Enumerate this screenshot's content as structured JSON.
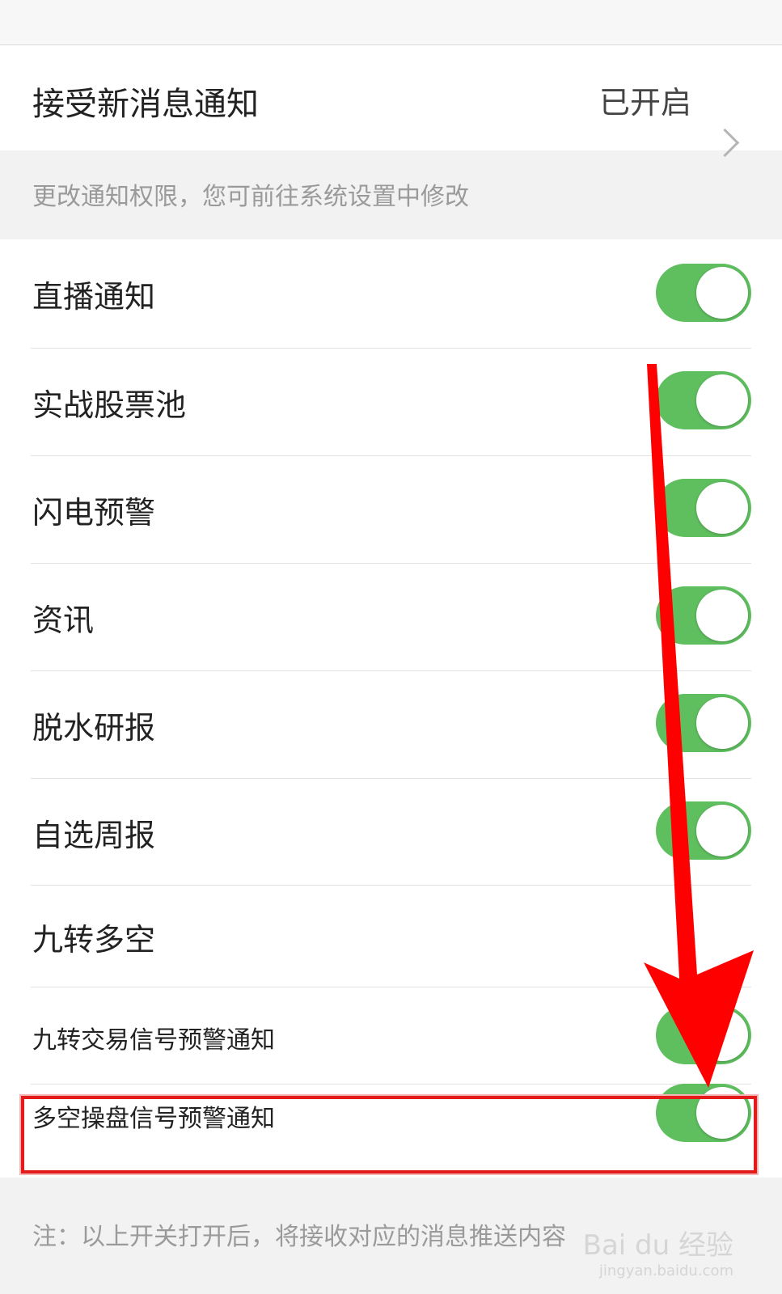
{
  "notification_row": {
    "label": "接受新消息通知",
    "status": "已开启"
  },
  "hint_top": "更改通知权限，您可前往系统设置中修改",
  "items": [
    {
      "label": "直播通知",
      "on": true
    },
    {
      "label": "实战股票池",
      "on": true
    },
    {
      "label": "闪电预警",
      "on": true
    },
    {
      "label": "资讯",
      "on": true
    },
    {
      "label": "脱水研报",
      "on": true
    },
    {
      "label": "自选周报",
      "on": true
    }
  ],
  "section": {
    "label": "九转多空"
  },
  "sub_items": [
    {
      "label": "九转交易信号预警通知",
      "on": true
    },
    {
      "label": "多空操盘信号预警通知",
      "on": true
    }
  ],
  "note": "注：以上开关打开后，将接收对应的消息推送内容",
  "watermark": {
    "brand": "Bai du 经验",
    "url": "jingyan.baidu.com"
  },
  "colors": {
    "toggle_on": "#5fbf5f",
    "highlight": "#e31b1b",
    "arrow": "#ff0000"
  },
  "icons": {
    "chevron": "chevron-right-icon"
  }
}
